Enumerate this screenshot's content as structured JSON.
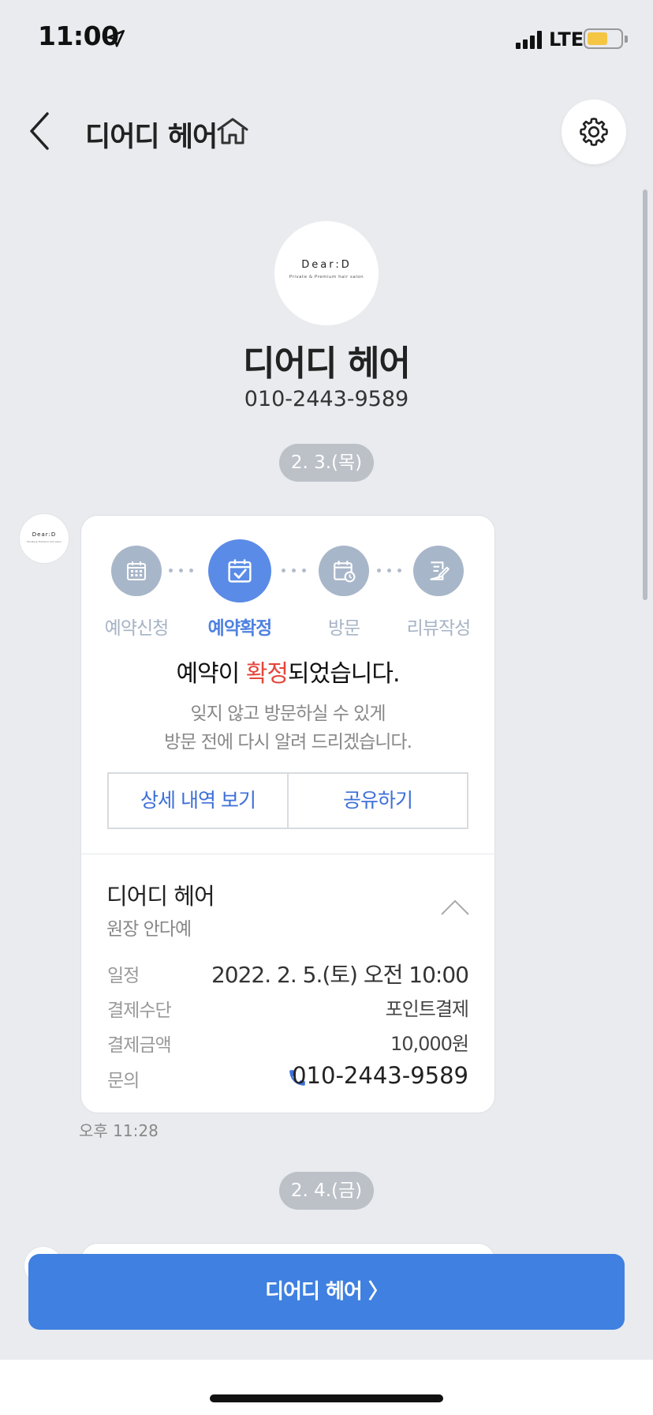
{
  "status_bar": {
    "time": "11:00",
    "network": "LTE",
    "battery_level": 0.6
  },
  "header": {
    "title": "디어디 헤어",
    "back_icon": "chevron-left-icon",
    "home_icon": "home-icon",
    "settings_icon": "gear-icon"
  },
  "profile": {
    "logo_text": "Dear:D",
    "logo_subtext": "Private & Premium hair salon",
    "name": "디어디 헤어",
    "phone": "010-2443-9589"
  },
  "dates": [
    "2. 3.(목)",
    "2. 4.(금)"
  ],
  "card": {
    "steps": [
      {
        "label": "예약신청",
        "icon": "calendar-icon",
        "active": false
      },
      {
        "label": "예약확정",
        "icon": "calendar-check-icon",
        "active": true
      },
      {
        "label": "방문",
        "icon": "calendar-clock-icon",
        "active": false
      },
      {
        "label": "리뷰작성",
        "icon": "review-edit-icon",
        "active": false
      }
    ],
    "title_prefix": "예약이 ",
    "title_highlight": "확정",
    "title_suffix": "되었습니다.",
    "desc_line1": "잊지 않고 방문하실 수 있게",
    "desc_line2": "방문 전에 다시 알려 드리겠습니다.",
    "detail_button": "상세 내역 보기",
    "share_button": "공유하기",
    "shop_name": "디어디 헤어",
    "designer": "원장 안다예",
    "rows": [
      {
        "label": "일정",
        "value": "2022. 2. 5.(토) 오전 10:00"
      },
      {
        "label": "결제수단",
        "value": "포인트결제"
      },
      {
        "label": "결제금액",
        "value": "10,000원"
      },
      {
        "label": "문의",
        "value": "010-2443-9589"
      }
    ]
  },
  "message_time": "오후 11:28",
  "cta": {
    "label": "디어디 헤어 〉"
  },
  "colors": {
    "accent": "#3f80e0",
    "step_active": "#5a8be6",
    "step_inactive": "#a8b6c9",
    "highlight_red": "#e5453b",
    "background": "#e9ebef"
  }
}
